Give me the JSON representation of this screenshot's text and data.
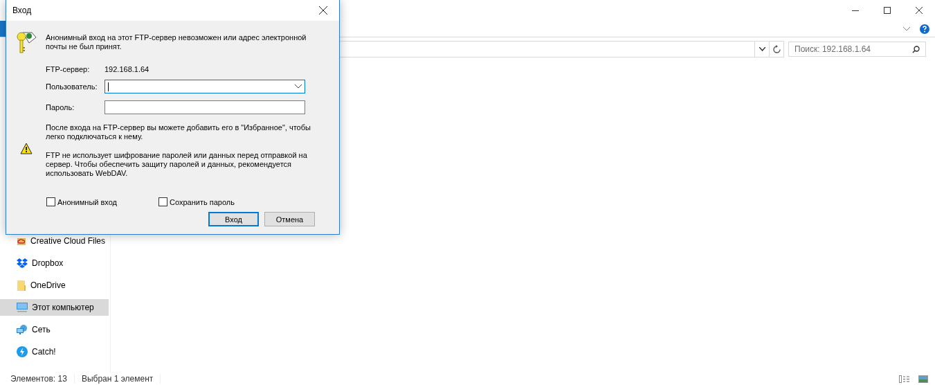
{
  "explorer": {
    "search_placeholder": "Поиск: 192.168.1.64",
    "sidebar": [
      {
        "label": "Creative Cloud Files",
        "kind": "creative-cloud",
        "selected": false
      },
      {
        "label": "Dropbox",
        "kind": "dropbox",
        "selected": false
      },
      {
        "label": "OneDrive",
        "kind": "folder",
        "selected": false
      },
      {
        "label": "Этот компьютер",
        "kind": "computer",
        "selected": true
      },
      {
        "label": "Сеть",
        "kind": "network",
        "selected": false
      },
      {
        "label": "Catch!",
        "kind": "catch",
        "selected": false
      }
    ],
    "status": [
      "Элементов: 13",
      "Выбран 1 элемент"
    ]
  },
  "dialog": {
    "title": "Вход",
    "message": "Анонимный вход на этот FTP-сервер невозможен или адрес электронной почты не был принят.",
    "server_label": "FTP-сервер:",
    "server": "192.168.1.64",
    "user_label": "Пользователь:",
    "password_label": "Пароль:",
    "info": "После входа на FTP-сервер вы можете добавить его в \"Избранное\", чтобы легко подключаться к нему.",
    "warning": "FTP не использует шифрование паролей или данных перед отправкой на сервер. Чтобы обеспечить защиту паролей и данных, рекомендуется использовать WebDAV.",
    "checkboxes": [
      {
        "label": "Анонимный вход",
        "checked": false
      },
      {
        "label": "Сохранить пароль",
        "checked": false
      }
    ],
    "buttons": [
      {
        "label": "Вход",
        "default": true
      },
      {
        "label": "Отмена",
        "default": false
      }
    ]
  }
}
